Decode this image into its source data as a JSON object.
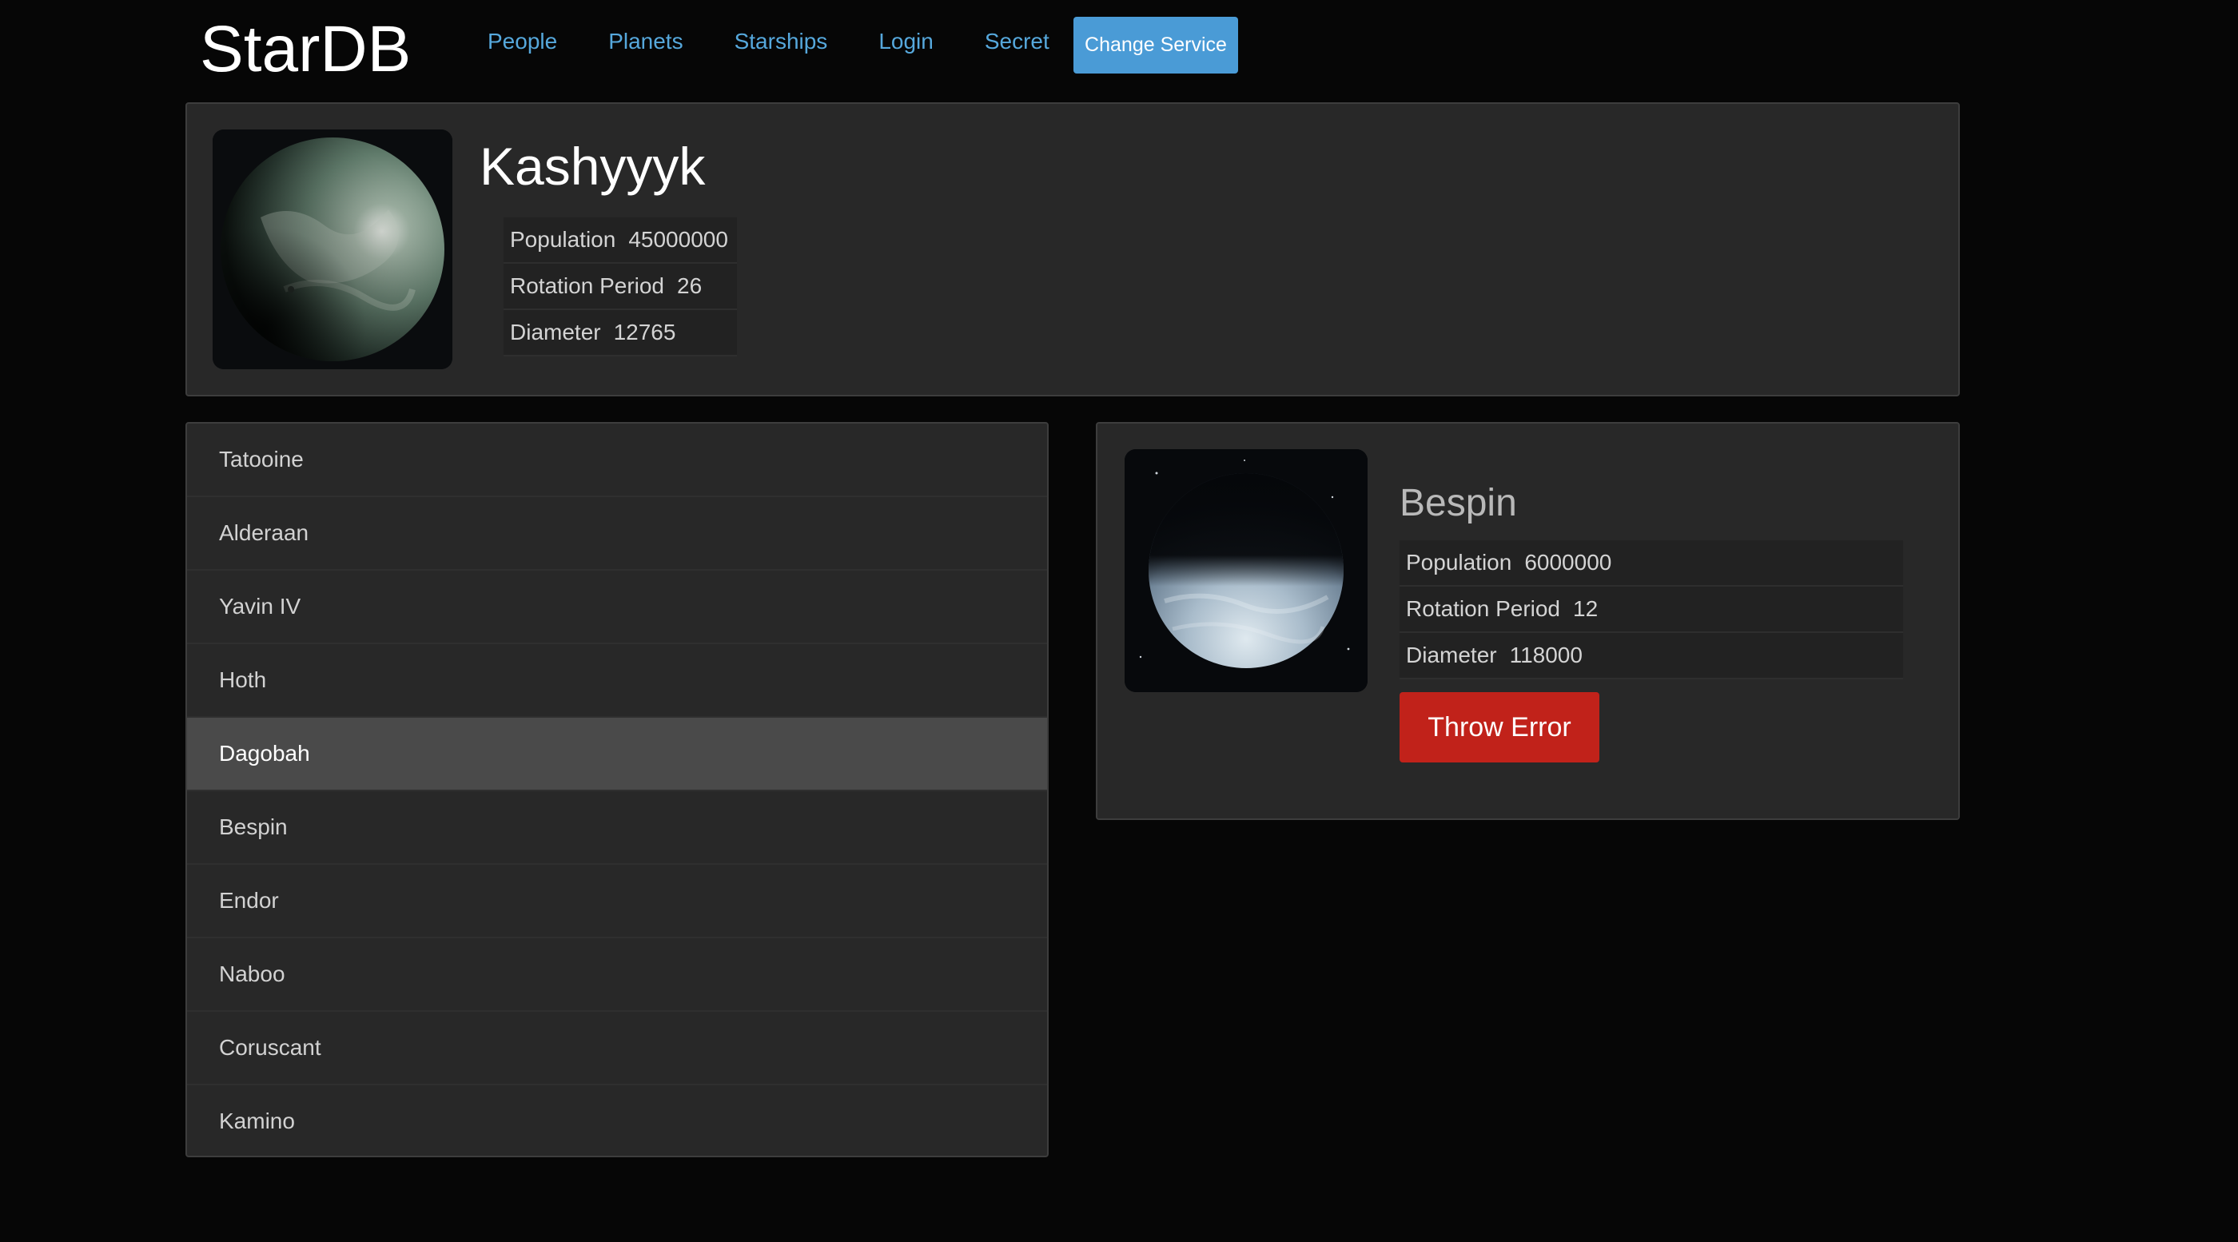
{
  "header": {
    "brand": "StarDB",
    "nav": [
      "People",
      "Planets",
      "Starships",
      "Login",
      "Secret"
    ],
    "change_service": "Change Service"
  },
  "random_planet": {
    "name": "Kashyyyk",
    "stats": [
      {
        "term": "Population",
        "value": "45000000"
      },
      {
        "term": "Rotation Period",
        "value": "26"
      },
      {
        "term": "Diameter",
        "value": "12765"
      }
    ]
  },
  "planet_list": {
    "items": [
      "Tatooine",
      "Alderaan",
      "Yavin IV",
      "Hoth",
      "Dagobah",
      "Bespin",
      "Endor",
      "Naboo",
      "Coruscant",
      "Kamino"
    ],
    "selected": "Dagobah"
  },
  "details": {
    "name": "Bespin",
    "stats": [
      {
        "term": "Population",
        "value": "6000000"
      },
      {
        "term": "Rotation Period",
        "value": "12"
      },
      {
        "term": "Diameter",
        "value": "118000"
      }
    ],
    "throw_error": "Throw Error"
  },
  "colors": {
    "background": "#060606",
    "panel": "#282828",
    "link": "#56a8dc",
    "primary_button": "#4a9bd6",
    "danger_button": "#c1221a",
    "active_item": "#4a4a4a"
  }
}
